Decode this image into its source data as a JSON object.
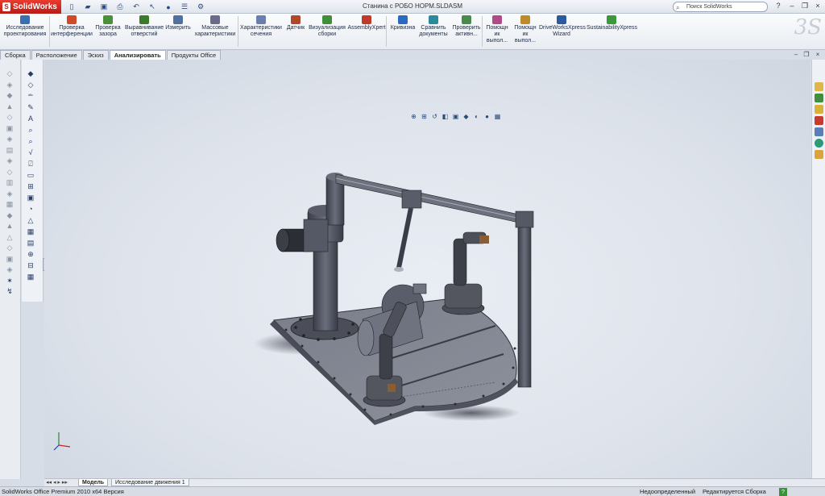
{
  "app": {
    "logo_text": "SolidWorks",
    "document_title": "Станина с РОБО НОРМ.SLDASM"
  },
  "search": {
    "placeholder": "Поиск SolidWorks"
  },
  "window_controls": {
    "help": "?",
    "minimize": "–",
    "maximize": "❐",
    "close": "×"
  },
  "command_manager": {
    "buttons": [
      {
        "id": "design-study",
        "label": "Исследование\nпроектирования",
        "icon": "design-study-icon",
        "color": "#3a6fb0"
      },
      {
        "id": "interference",
        "label": "Проверка\nинтерференции",
        "icon": "interference-icon",
        "color": "#d04a2a"
      },
      {
        "id": "clearance",
        "label": "Проверка\nзазора",
        "icon": "clearance-icon",
        "color": "#4a8f3a"
      },
      {
        "id": "hole-align",
        "label": "Выравнивание\nотверстий",
        "icon": "hole-align-icon",
        "color": "#3b7a2a"
      },
      {
        "id": "measure",
        "label": "Измерить",
        "icon": "measure-icon",
        "color": "#5070a0"
      },
      {
        "id": "mass-props",
        "label": "Массовые\nхарактеристики",
        "icon": "mass-props-icon",
        "color": "#6a6a8a"
      },
      {
        "id": "section-props",
        "label": "Характеристики\nсечения",
        "icon": "section-props-icon",
        "color": "#6a7fb0"
      },
      {
        "id": "sensor",
        "label": "Датчик",
        "icon": "sensor-icon",
        "color": "#b0462a"
      },
      {
        "id": "assembly-viz",
        "label": "Визуализация\nсборки",
        "icon": "assembly-viz-icon",
        "color": "#3f8f3a"
      },
      {
        "id": "assemblyxpert",
        "label": "AssemblyXpert",
        "icon": "assemblyxpert-icon",
        "color": "#c0392b"
      },
      {
        "id": "curvature",
        "label": "Кривизна",
        "icon": "curvature-icon",
        "color": "#2a6ac0"
      },
      {
        "id": "compare-docs",
        "label": "Сравнить\nдокументы",
        "icon": "compare-icon",
        "color": "#2a8a9a"
      },
      {
        "id": "check-active",
        "label": "Проверить\nактивн...",
        "icon": "check-active-icon",
        "color": "#4a8a4a"
      },
      {
        "id": "help-1",
        "label": "Помощн\nик\nвыпол...",
        "icon": "helper-icon",
        "color": "#b04a8a"
      },
      {
        "id": "help-2",
        "label": "Помощн\nик\nвыпол...",
        "icon": "helper-icon",
        "color": "#c08a2a"
      },
      {
        "id": "driveworks",
        "label": "DriveWorksXpress\nWizard",
        "icon": "driveworks-icon",
        "color": "#2a5aa0"
      },
      {
        "id": "sustainability",
        "label": "SustainabilityXpress",
        "icon": "sustainability-icon",
        "color": "#3a9a3a"
      }
    ]
  },
  "tabs": [
    {
      "label": "Сборка",
      "active": false
    },
    {
      "label": "Расположение",
      "active": false
    },
    {
      "label": "Эскиз",
      "active": false
    },
    {
      "label": "Анализировать",
      "active": true
    },
    {
      "label": "Продукты Office",
      "active": false
    }
  ],
  "bottom_tabs": [
    {
      "label": "Модель",
      "active": true
    },
    {
      "label": "Исследование движения 1",
      "active": false
    }
  ],
  "status": {
    "product": "SolidWorks Office Premium 2010 x64 Версия",
    "defined": "Недоопределенный",
    "editing": "Редактируется Сборка",
    "help": "?"
  }
}
